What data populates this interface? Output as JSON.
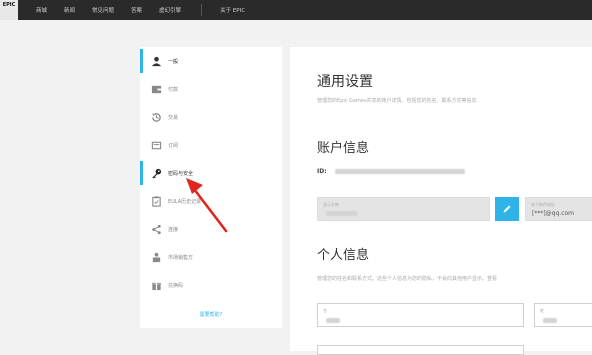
{
  "nav": {
    "logo": "EPIC",
    "links": [
      "商城",
      "新闻",
      "常见问题",
      "答案",
      "虚幻引擎"
    ],
    "about": "关于 EPIC"
  },
  "sidebar": {
    "items": [
      {
        "label": "一般",
        "icon": "user-icon"
      },
      {
        "label": "付款",
        "icon": "wallet-icon"
      },
      {
        "label": "交易",
        "icon": "history-icon"
      },
      {
        "label": "订阅",
        "icon": "subscription-icon"
      },
      {
        "label": "密码与安全",
        "icon": "key-icon"
      },
      {
        "label": "EULA历史记录",
        "icon": "document-icon"
      },
      {
        "label": "连接",
        "icon": "share-icon"
      },
      {
        "label": "市场销售方",
        "icon": "seller-icon"
      },
      {
        "label": "兑换码",
        "icon": "redeem-icon"
      }
    ],
    "help_link": "需要帮助?"
  },
  "main": {
    "title": "通用设置",
    "description": "管理您的Epic Games共享的账户详情，包括您的姓名、联系方式等信息",
    "account": {
      "title": "账户信息",
      "id_label": "ID:",
      "display_name_label": "显示名称",
      "email_label": "电子邮件地址",
      "email_value": "[***]@qq.com"
    },
    "personal": {
      "title": "个人信息",
      "description": "管理您的姓名和联系方式。这些个人信息为您的隐私，不会向其他用户显示。查看",
      "first_name_label": "名",
      "last_name_label": "姓"
    }
  }
}
